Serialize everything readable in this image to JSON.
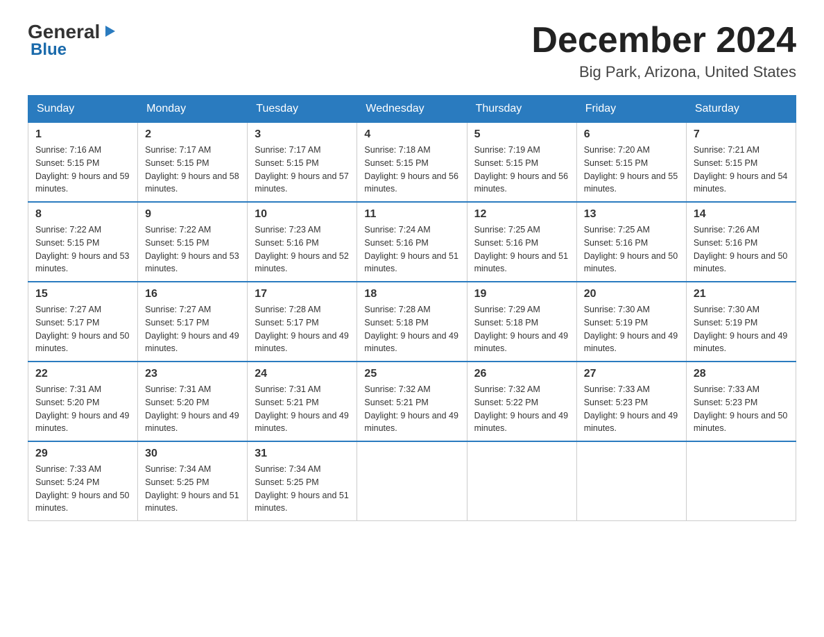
{
  "logo": {
    "general": "General",
    "blue": "Blue",
    "triangle_alt": "▶"
  },
  "header": {
    "month_title": "December 2024",
    "location": "Big Park, Arizona, United States"
  },
  "days_of_week": [
    "Sunday",
    "Monday",
    "Tuesday",
    "Wednesday",
    "Thursday",
    "Friday",
    "Saturday"
  ],
  "weeks": [
    [
      {
        "day": "1",
        "sunrise": "7:16 AM",
        "sunset": "5:15 PM",
        "daylight": "9 hours and 59 minutes."
      },
      {
        "day": "2",
        "sunrise": "7:17 AM",
        "sunset": "5:15 PM",
        "daylight": "9 hours and 58 minutes."
      },
      {
        "day": "3",
        "sunrise": "7:17 AM",
        "sunset": "5:15 PM",
        "daylight": "9 hours and 57 minutes."
      },
      {
        "day": "4",
        "sunrise": "7:18 AM",
        "sunset": "5:15 PM",
        "daylight": "9 hours and 56 minutes."
      },
      {
        "day": "5",
        "sunrise": "7:19 AM",
        "sunset": "5:15 PM",
        "daylight": "9 hours and 56 minutes."
      },
      {
        "day": "6",
        "sunrise": "7:20 AM",
        "sunset": "5:15 PM",
        "daylight": "9 hours and 55 minutes."
      },
      {
        "day": "7",
        "sunrise": "7:21 AM",
        "sunset": "5:15 PM",
        "daylight": "9 hours and 54 minutes."
      }
    ],
    [
      {
        "day": "8",
        "sunrise": "7:22 AM",
        "sunset": "5:15 PM",
        "daylight": "9 hours and 53 minutes."
      },
      {
        "day": "9",
        "sunrise": "7:22 AM",
        "sunset": "5:15 PM",
        "daylight": "9 hours and 53 minutes."
      },
      {
        "day": "10",
        "sunrise": "7:23 AM",
        "sunset": "5:16 PM",
        "daylight": "9 hours and 52 minutes."
      },
      {
        "day": "11",
        "sunrise": "7:24 AM",
        "sunset": "5:16 PM",
        "daylight": "9 hours and 51 minutes."
      },
      {
        "day": "12",
        "sunrise": "7:25 AM",
        "sunset": "5:16 PM",
        "daylight": "9 hours and 51 minutes."
      },
      {
        "day": "13",
        "sunrise": "7:25 AM",
        "sunset": "5:16 PM",
        "daylight": "9 hours and 50 minutes."
      },
      {
        "day": "14",
        "sunrise": "7:26 AM",
        "sunset": "5:16 PM",
        "daylight": "9 hours and 50 minutes."
      }
    ],
    [
      {
        "day": "15",
        "sunrise": "7:27 AM",
        "sunset": "5:17 PM",
        "daylight": "9 hours and 50 minutes."
      },
      {
        "day": "16",
        "sunrise": "7:27 AM",
        "sunset": "5:17 PM",
        "daylight": "9 hours and 49 minutes."
      },
      {
        "day": "17",
        "sunrise": "7:28 AM",
        "sunset": "5:17 PM",
        "daylight": "9 hours and 49 minutes."
      },
      {
        "day": "18",
        "sunrise": "7:28 AM",
        "sunset": "5:18 PM",
        "daylight": "9 hours and 49 minutes."
      },
      {
        "day": "19",
        "sunrise": "7:29 AM",
        "sunset": "5:18 PM",
        "daylight": "9 hours and 49 minutes."
      },
      {
        "day": "20",
        "sunrise": "7:30 AM",
        "sunset": "5:19 PM",
        "daylight": "9 hours and 49 minutes."
      },
      {
        "day": "21",
        "sunrise": "7:30 AM",
        "sunset": "5:19 PM",
        "daylight": "9 hours and 49 minutes."
      }
    ],
    [
      {
        "day": "22",
        "sunrise": "7:31 AM",
        "sunset": "5:20 PM",
        "daylight": "9 hours and 49 minutes."
      },
      {
        "day": "23",
        "sunrise": "7:31 AM",
        "sunset": "5:20 PM",
        "daylight": "9 hours and 49 minutes."
      },
      {
        "day": "24",
        "sunrise": "7:31 AM",
        "sunset": "5:21 PM",
        "daylight": "9 hours and 49 minutes."
      },
      {
        "day": "25",
        "sunrise": "7:32 AM",
        "sunset": "5:21 PM",
        "daylight": "9 hours and 49 minutes."
      },
      {
        "day": "26",
        "sunrise": "7:32 AM",
        "sunset": "5:22 PM",
        "daylight": "9 hours and 49 minutes."
      },
      {
        "day": "27",
        "sunrise": "7:33 AM",
        "sunset": "5:23 PM",
        "daylight": "9 hours and 49 minutes."
      },
      {
        "day": "28",
        "sunrise": "7:33 AM",
        "sunset": "5:23 PM",
        "daylight": "9 hours and 50 minutes."
      }
    ],
    [
      {
        "day": "29",
        "sunrise": "7:33 AM",
        "sunset": "5:24 PM",
        "daylight": "9 hours and 50 minutes."
      },
      {
        "day": "30",
        "sunrise": "7:34 AM",
        "sunset": "5:25 PM",
        "daylight": "9 hours and 51 minutes."
      },
      {
        "day": "31",
        "sunrise": "7:34 AM",
        "sunset": "5:25 PM",
        "daylight": "9 hours and 51 minutes."
      },
      null,
      null,
      null,
      null
    ]
  ],
  "labels": {
    "sunrise": "Sunrise:",
    "sunset": "Sunset:",
    "daylight": "Daylight:"
  }
}
